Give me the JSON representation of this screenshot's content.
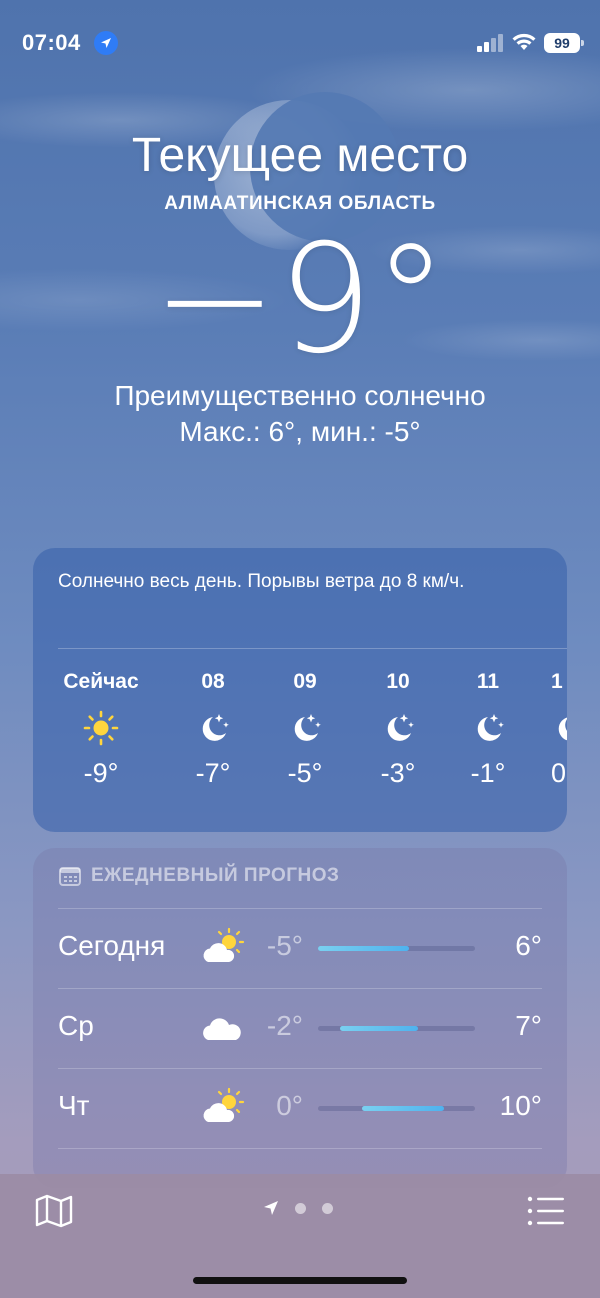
{
  "status_bar": {
    "time": "07:04",
    "battery": "99",
    "icons": [
      "location-arrow-icon",
      "cellular-signal-icon",
      "wifi-icon",
      "battery-icon"
    ]
  },
  "header": {
    "city": "Текущее место",
    "region": "АЛМААТИНСКАЯ ОБЛАСТЬ",
    "temperature": "−9°",
    "condition": "Преимущественно солнечно",
    "high_low": "Макс.: 6°, мин.: -5°"
  },
  "hourly": {
    "summary": "Солнечно весь день. Порывы ветра до 8 км/ч.",
    "items": [
      {
        "label": "Сейчас",
        "icon": "sun-icon",
        "temp": "-9°"
      },
      {
        "label": "08",
        "icon": "moon-stars-icon",
        "temp": "-7°"
      },
      {
        "label": "09",
        "icon": "moon-stars-icon",
        "temp": "-5°"
      },
      {
        "label": "10",
        "icon": "moon-stars-icon",
        "temp": "-3°"
      },
      {
        "label": "11",
        "icon": "moon-stars-icon",
        "temp": "-1°"
      },
      {
        "label": "1",
        "icon": "moon-stars-icon",
        "temp": "0"
      }
    ]
  },
  "daily": {
    "title": "ЕЖЕДНЕВНЫЙ ПРОГНОЗ",
    "days": [
      {
        "name": "Сегодня",
        "icon": "partly-sunny-icon",
        "low": "-5°",
        "high": "6°",
        "range_start": 0.0,
        "range_end": 0.58
      },
      {
        "name": "Ср",
        "icon": "cloud-icon",
        "low": "-2°",
        "high": "7°",
        "range_start": 0.14,
        "range_end": 0.64
      },
      {
        "name": "Чт",
        "icon": "partly-sunny-icon",
        "low": "0°",
        "high": "10°",
        "range_start": 0.28,
        "range_end": 0.8
      }
    ]
  },
  "tabbar": {
    "page_count": 3,
    "active_page": 0,
    "icons": [
      "map-icon",
      "location-arrow-icon",
      "list-icon"
    ]
  },
  "colors": {
    "bar_fill": "#4fb2ee",
    "location_badge": "#2f7cf6"
  }
}
